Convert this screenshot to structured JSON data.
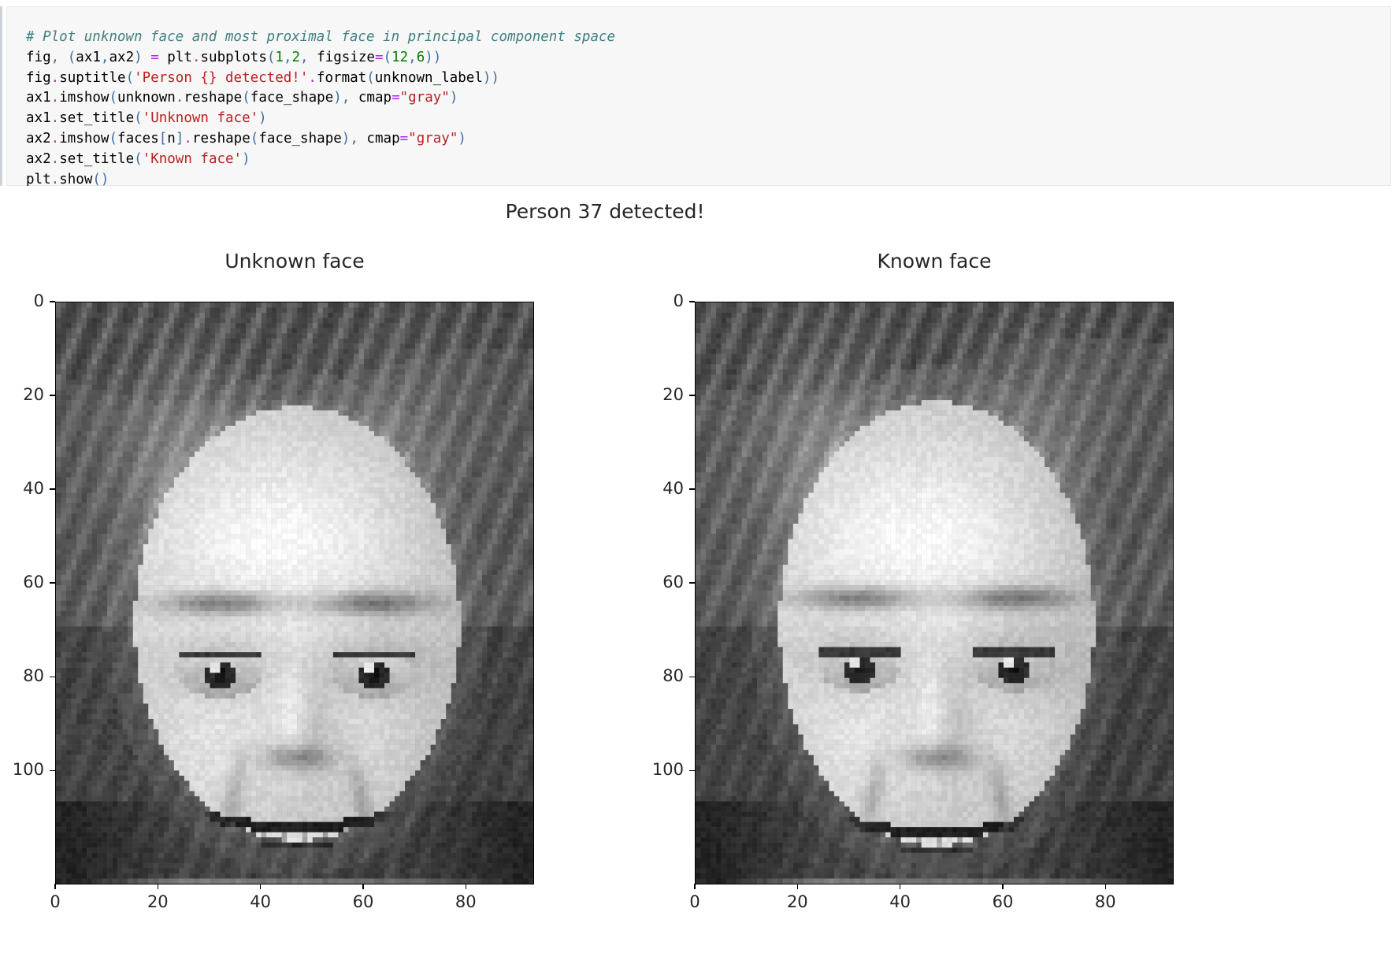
{
  "code_cell": {
    "language": "python",
    "accent_color": "#cfd4da",
    "background": "#f7f7f7",
    "lines": [
      "# Plot unknown face and most proximal face in principal component space",
      "fig, (ax1,ax2) = plt.subplots(1,2, figsize=(12,6))",
      "fig.suptitle('Person {} detected!'.format(unknown_label))",
      "ax1.imshow(unknown.reshape(face_shape), cmap=\"gray\")",
      "ax1.set_title('Unknown face')",
      "ax2.imshow(faces[n].reshape(face_shape), cmap=\"gray\")",
      "ax2.set_title('Known face')",
      "plt.show()"
    ]
  },
  "figure": {
    "suptitle": "Person 37 detected!",
    "detected_person_id": "37"
  },
  "chart_data": {
    "type": "heatmap",
    "title": "Person 37 detected!",
    "grid": false,
    "legend": null,
    "panels": [
      {
        "title": "Unknown face",
        "cmap": "gray",
        "xlabel": "",
        "ylabel": "",
        "xlim": [
          0,
          93
        ],
        "ylim": [
          124,
          0
        ],
        "xticks": [
          "0",
          "20",
          "40",
          "60",
          "80"
        ],
        "xtick_values": [
          0,
          20,
          40,
          60,
          80
        ],
        "yticks": [
          "0",
          "20",
          "40",
          "60",
          "80",
          "100"
        ],
        "ytick_values": [
          0,
          20,
          40,
          60,
          80,
          100
        ]
      },
      {
        "title": "Known face",
        "cmap": "gray",
        "xlabel": "",
        "ylabel": "",
        "xlim": [
          0,
          93
        ],
        "ylim": [
          124,
          0
        ],
        "xticks": [
          "0",
          "20",
          "40",
          "60",
          "80"
        ],
        "xtick_values": [
          0,
          20,
          40,
          60,
          80
        ],
        "yticks": [
          "0",
          "20",
          "40",
          "60",
          "80",
          "100"
        ],
        "ytick_values": [
          0,
          20,
          40,
          60,
          80,
          100
        ]
      }
    ]
  }
}
